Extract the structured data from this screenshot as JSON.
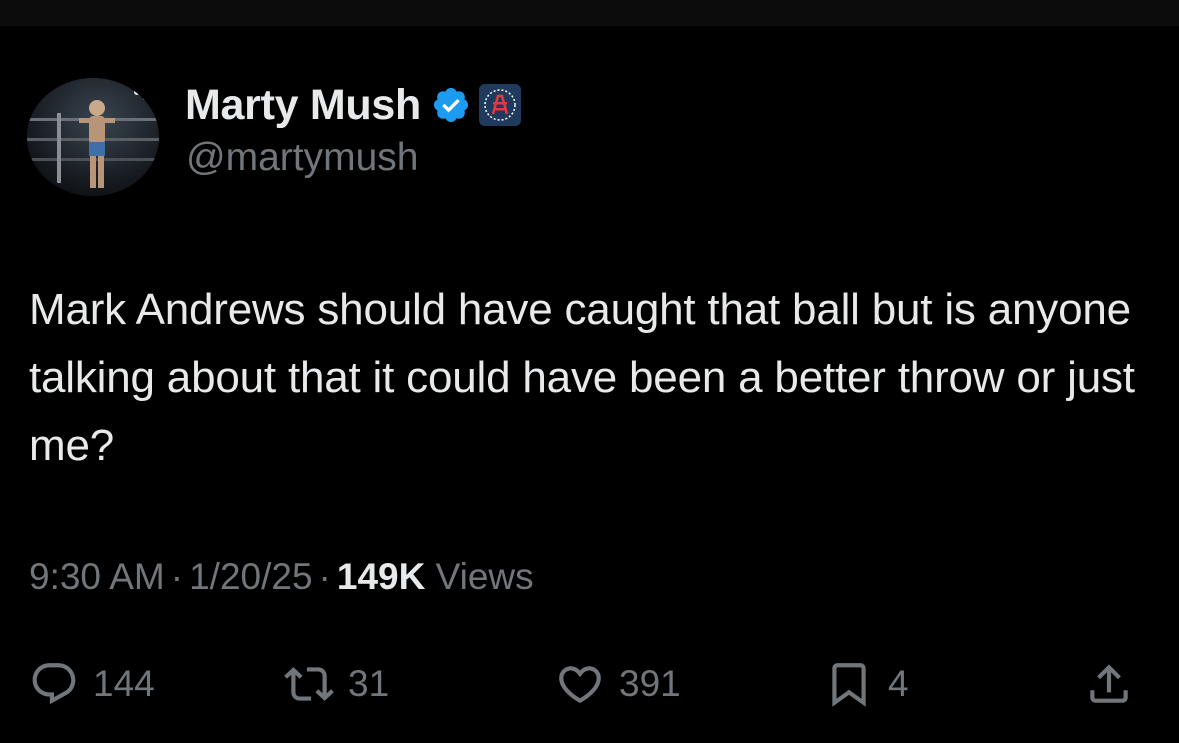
{
  "author": {
    "display_name": "Marty Mush",
    "handle": "@martymush",
    "verified_icon": "verified-badge-icon",
    "affiliate_icon": "barstool-affiliate-icon"
  },
  "tweet": {
    "text": "Mark Andrews should have caught that ball but is anyone talking about that it could have been a better throw or just me?",
    "time": "9:30 AM",
    "separator": "·",
    "date": "1/20/25",
    "views_count": "149K",
    "views_label": "Views"
  },
  "actions": {
    "replies": "144",
    "retweets": "31",
    "likes": "391",
    "bookmarks": "4"
  },
  "colors": {
    "background": "#000000",
    "primary_text": "#e7e9ea",
    "secondary_text": "#71767b",
    "verified_blue": "#1d9bf0"
  }
}
